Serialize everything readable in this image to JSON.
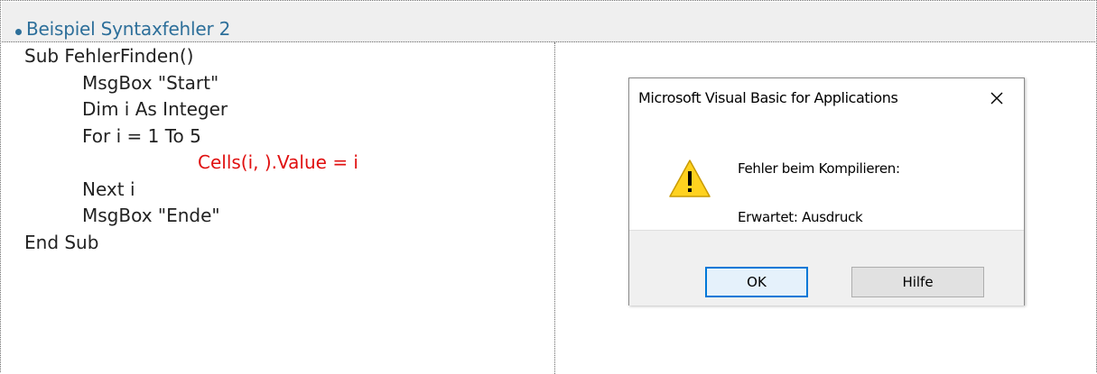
{
  "header": {
    "title": "Beispiel Syntaxfehler 2",
    "accent_color": "#2d6f9a"
  },
  "code": {
    "lines": [
      "Sub FehlerFinden()",
      "MsgBox \"Start\"",
      "Dim i As Integer",
      "For i = 1 To 5",
      "Cells(i, ).Value = i",
      "Next i",
      "MsgBox \"Ende\"",
      "End Sub"
    ],
    "error_color": "#e01010"
  },
  "dialog": {
    "title": "Microsoft Visual Basic for Applications",
    "close_icon": "close-icon",
    "warning_icon": "warning-icon",
    "message_title": "Fehler beim Kompilieren:",
    "message_detail": "Erwartet: Ausdruck",
    "ok_label": "OK",
    "help_label": "Hilfe",
    "ok_border_color": "#0078d7"
  }
}
